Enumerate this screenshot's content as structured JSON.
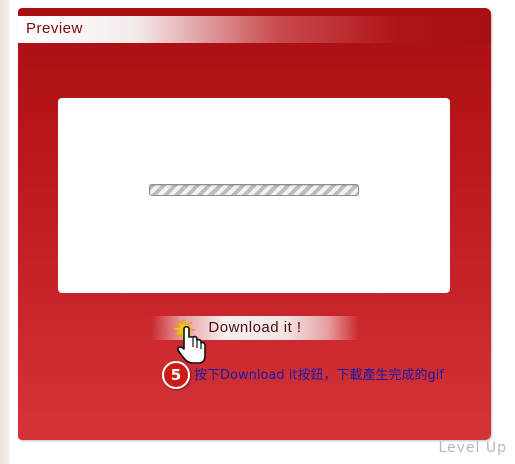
{
  "preview_panel": {
    "title": "Preview",
    "progress": {
      "state": "indeterminate"
    },
    "download_button": {
      "label": "Download it !"
    }
  },
  "annotation": {
    "step_number": "5",
    "caption": "按下Download it按鈕，下載產生完成的gif",
    "cursor_icon": "hand-pointer-icon",
    "burst_icon": "click-burst-icon"
  },
  "watermark": {
    "text": "Level Up"
  },
  "colors": {
    "panel_red": "#b8161b",
    "step_badge_red": "#cc1b16",
    "caption_blue": "#1a1aa6"
  }
}
